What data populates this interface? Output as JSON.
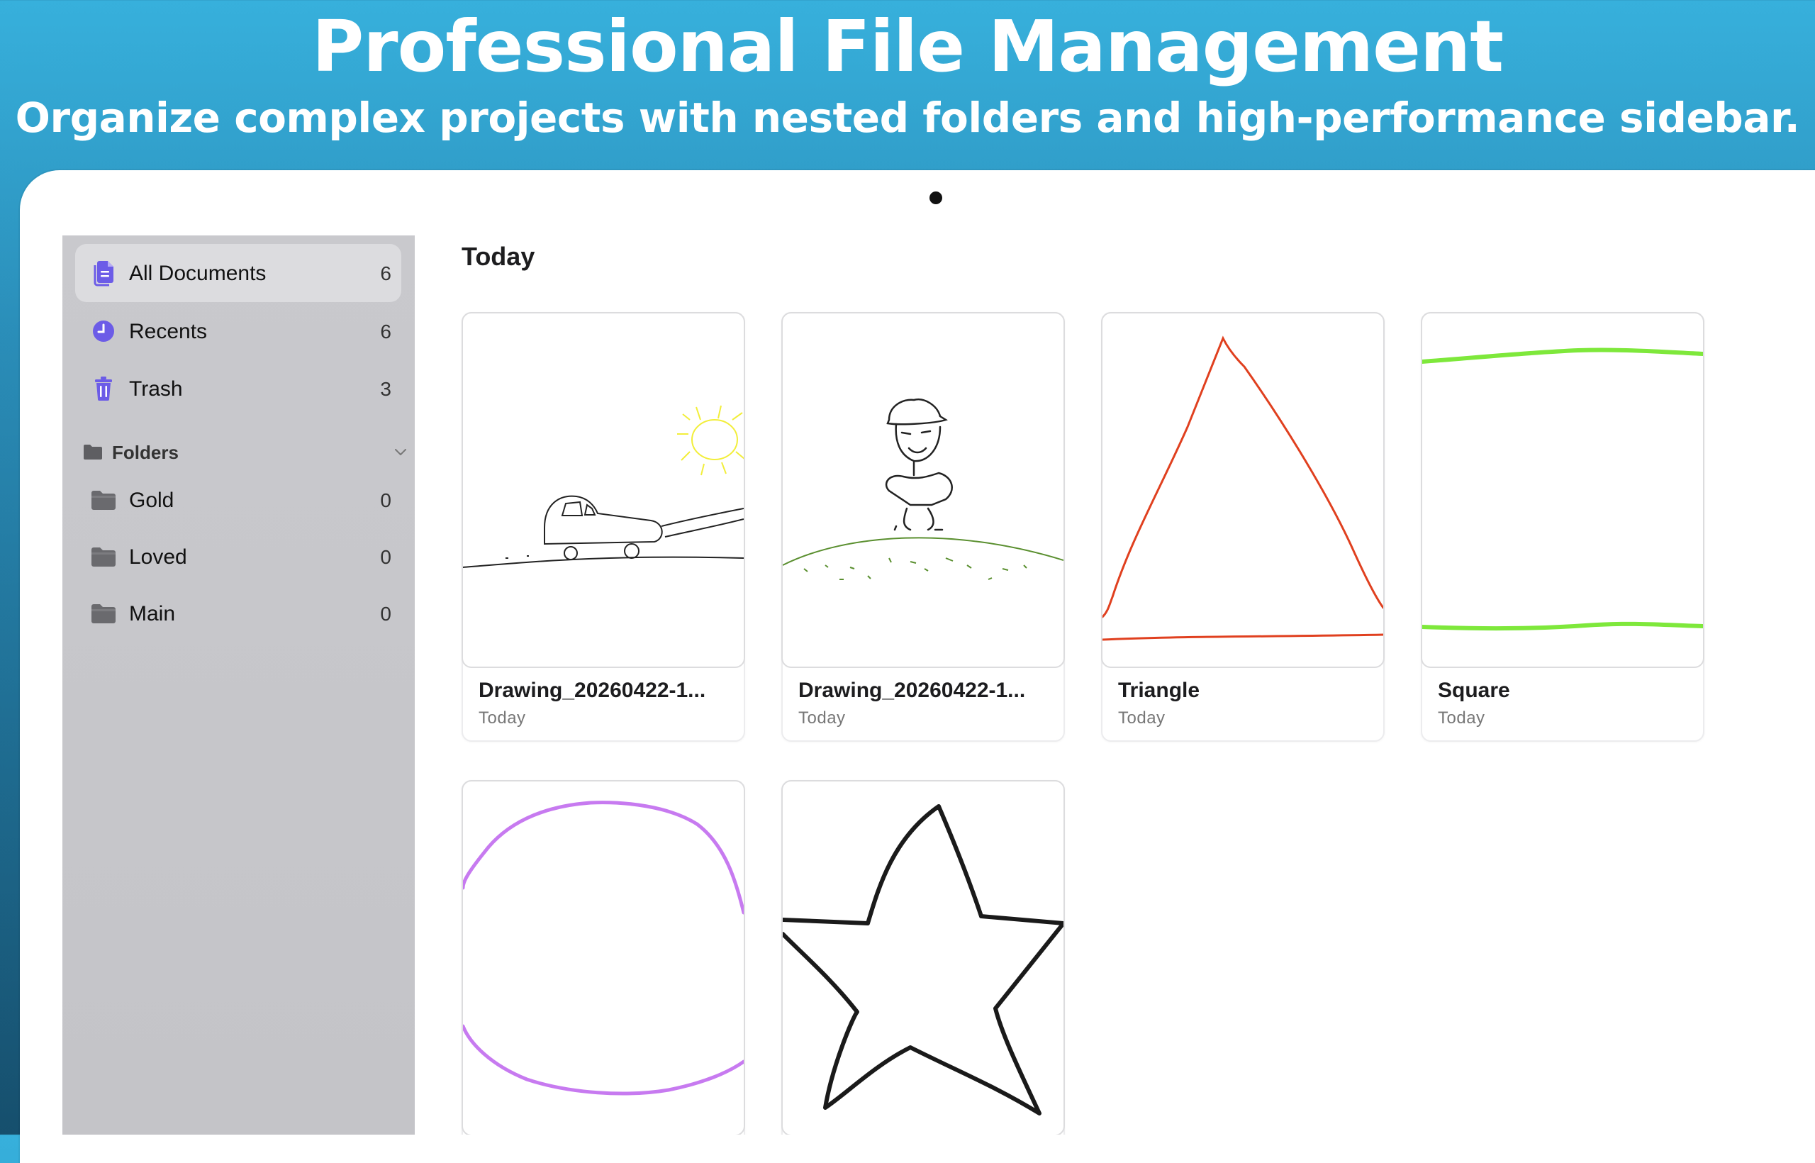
{
  "hero": {
    "title": "Professional File Management",
    "subtitle": "Organize complex projects with nested folders and high-performance sidebar."
  },
  "sidebar": {
    "items": [
      {
        "label": "All Documents",
        "count": "6",
        "icon": "documents-icon",
        "selected": true
      },
      {
        "label": "Recents",
        "count": "6",
        "icon": "clock-icon"
      },
      {
        "label": "Trash",
        "count": "3",
        "icon": "trash-icon"
      }
    ],
    "folders_header": "Folders",
    "folders": [
      {
        "label": "Gold",
        "count": "0",
        "icon": "folder-icon"
      },
      {
        "label": "Loved",
        "count": "0",
        "icon": "folder-icon"
      },
      {
        "label": "Main",
        "count": "0",
        "icon": "folder-icon"
      }
    ]
  },
  "main": {
    "section_title": "Today",
    "documents": [
      {
        "name": "Drawing_20260422-1...",
        "date": "Today"
      },
      {
        "name": "Drawing_20260422-1...",
        "date": "Today"
      },
      {
        "name": "Triangle",
        "date": "Today"
      },
      {
        "name": "Square",
        "date": "Today"
      },
      {
        "name": "",
        "date": ""
      },
      {
        "name": "",
        "date": ""
      }
    ]
  },
  "colors": {
    "accent": "#6c5ce7",
    "sidebar_bg": "#c7c7cb",
    "triangle_stroke": "#e0401f",
    "square_stroke": "#7ee83b",
    "circle_stroke": "#c77af0",
    "sun_stroke": "#f2ee3a",
    "grass_stroke": "#5a8f2f"
  }
}
